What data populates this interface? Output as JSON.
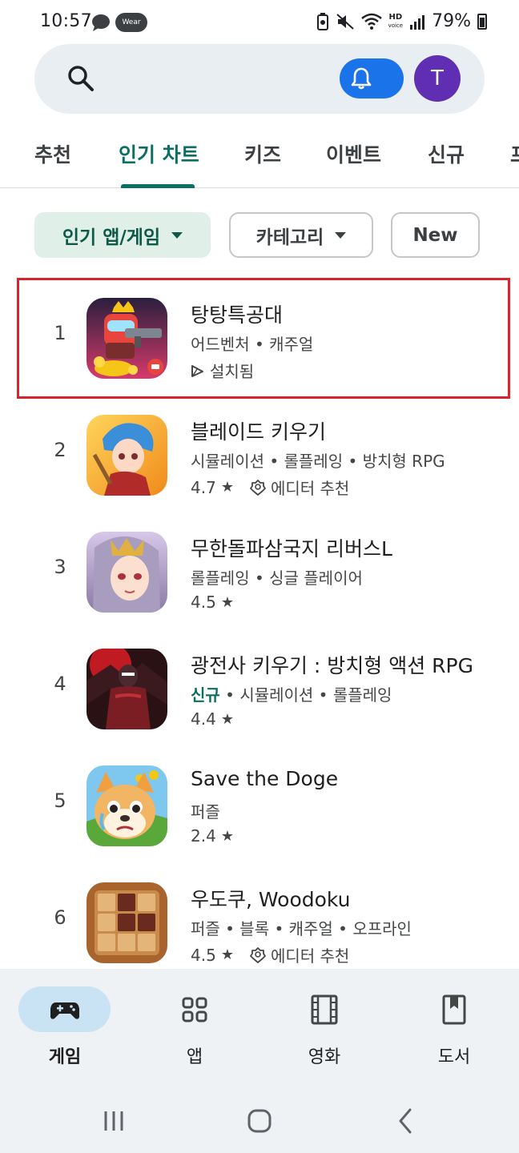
{
  "status_bar": {
    "time": "10:57",
    "wear_label": "Wear",
    "hd_label": "HD",
    "voice_label": "voice",
    "battery": "79%"
  },
  "search": {
    "avatar_letter": "T"
  },
  "tabs": [
    {
      "label": "추천",
      "active": false
    },
    {
      "label": "인기 차트",
      "active": true
    },
    {
      "label": "키즈",
      "active": false
    },
    {
      "label": "이벤트",
      "active": false
    },
    {
      "label": "신규",
      "active": false
    },
    {
      "label": "프",
      "active": false
    }
  ],
  "chips": [
    {
      "label": "인기 앱/게임",
      "selected": true,
      "dropdown": true
    },
    {
      "label": "카테고리",
      "selected": false,
      "dropdown": true
    },
    {
      "label": "New",
      "selected": false,
      "dropdown": false
    }
  ],
  "apps": [
    {
      "rank": "1",
      "title": "탕탕특공대",
      "categories": "어드벤처 • 캐주얼",
      "meta": "설치됨",
      "installed": true
    },
    {
      "rank": "2",
      "title": "블레이드 키우기",
      "categories": "시뮬레이션 • 롤플레잉 • 방치형 RPG",
      "rating": "4.7",
      "editor": "에디터 추천"
    },
    {
      "rank": "3",
      "title": "무한돌파삼국지 리버스L",
      "categories": "롤플레잉 • 싱글 플레이어",
      "rating": "4.5"
    },
    {
      "rank": "4",
      "title": "광전사 키우기 : 방치형 액션 RPG",
      "new_tag": "신규",
      "categories": "• 시뮬레이션 • 롤플레잉",
      "rating": "4.4"
    },
    {
      "rank": "5",
      "title": "Save the Doge",
      "categories": "퍼즐",
      "rating": "2.4"
    },
    {
      "rank": "6",
      "title": "우도쿠, Woodoku",
      "categories": "퍼즐 • 블록 • 캐주얼 • 오프라인",
      "rating": "4.5",
      "editor": "에디터 추천"
    }
  ],
  "star_glyph": "★",
  "bottom_nav": [
    {
      "label": "게임",
      "icon": "gamepad-icon",
      "active": true
    },
    {
      "label": "앱",
      "icon": "apps-grid-icon",
      "active": false
    },
    {
      "label": "영화",
      "icon": "film-icon",
      "active": false
    },
    {
      "label": "도서",
      "icon": "book-icon",
      "active": false
    }
  ],
  "colors": {
    "accent": "#0b6e64",
    "highlight": "#d9232d",
    "notify": "#1a73e8",
    "avatar": "#5f2eb3"
  }
}
